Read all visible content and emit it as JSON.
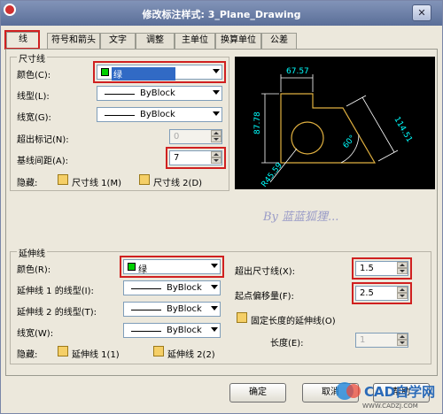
{
  "window": {
    "title": "修改标注样式: 3_Plane_Drawing"
  },
  "tabs": [
    {
      "label": "线"
    },
    {
      "label": "符号和箭头"
    },
    {
      "label": "文字"
    },
    {
      "label": "调整"
    },
    {
      "label": "主单位"
    },
    {
      "label": "换算单位"
    },
    {
      "label": "公差"
    }
  ],
  "dim_line": {
    "group_title": "尺寸线",
    "color_label": "颜色(C):",
    "color_value": "绿",
    "linetype_label": "线型(L):",
    "linetype_value": "ByBlock",
    "lineweight_label": "线宽(G):",
    "lineweight_value": "ByBlock",
    "extend_label": "超出标记(N):",
    "extend_value": "0",
    "baseline_label": "基线间距(A):",
    "baseline_value": "7",
    "suppress_label": "隐藏:",
    "suppress1_label": "尺寸线 1(M)",
    "suppress2_label": "尺寸线 2(D)"
  },
  "preview": {
    "dim_top": "67.57",
    "dim_left": "87.78",
    "dim_right": "114.51",
    "dim_angle": "60°",
    "dim_radius": "R45.59"
  },
  "watermark": "By 蓝蓝狐狸...",
  "ext_line": {
    "group_title": "延伸线",
    "color_label": "颜色(R):",
    "color_value": "绿",
    "linetype1_label": "延伸线 1 的线型(I):",
    "linetype1_value": "ByBlock",
    "linetype2_label": "延伸线 2 的线型(T):",
    "linetype2_value": "ByBlock",
    "lineweight_label": "线宽(W):",
    "lineweight_value": "ByBlock",
    "suppress_label": "隐藏:",
    "suppress1_label": "延伸线 1(1)",
    "suppress2_label": "延伸线 2(2)",
    "beyond_label": "超出尺寸线(X):",
    "beyond_value": "1.5",
    "offset_label": "起点偏移量(F):",
    "offset_value": "2.5",
    "fixed_label": "固定长度的延伸线(O)",
    "length_label": "长度(E):",
    "length_value": "1"
  },
  "buttons": {
    "ok": "确定",
    "cancel": "取消",
    "help": "帮助"
  },
  "site_logo": {
    "text": "CAD自学网",
    "url": "WWW.CADZJ.COM"
  }
}
